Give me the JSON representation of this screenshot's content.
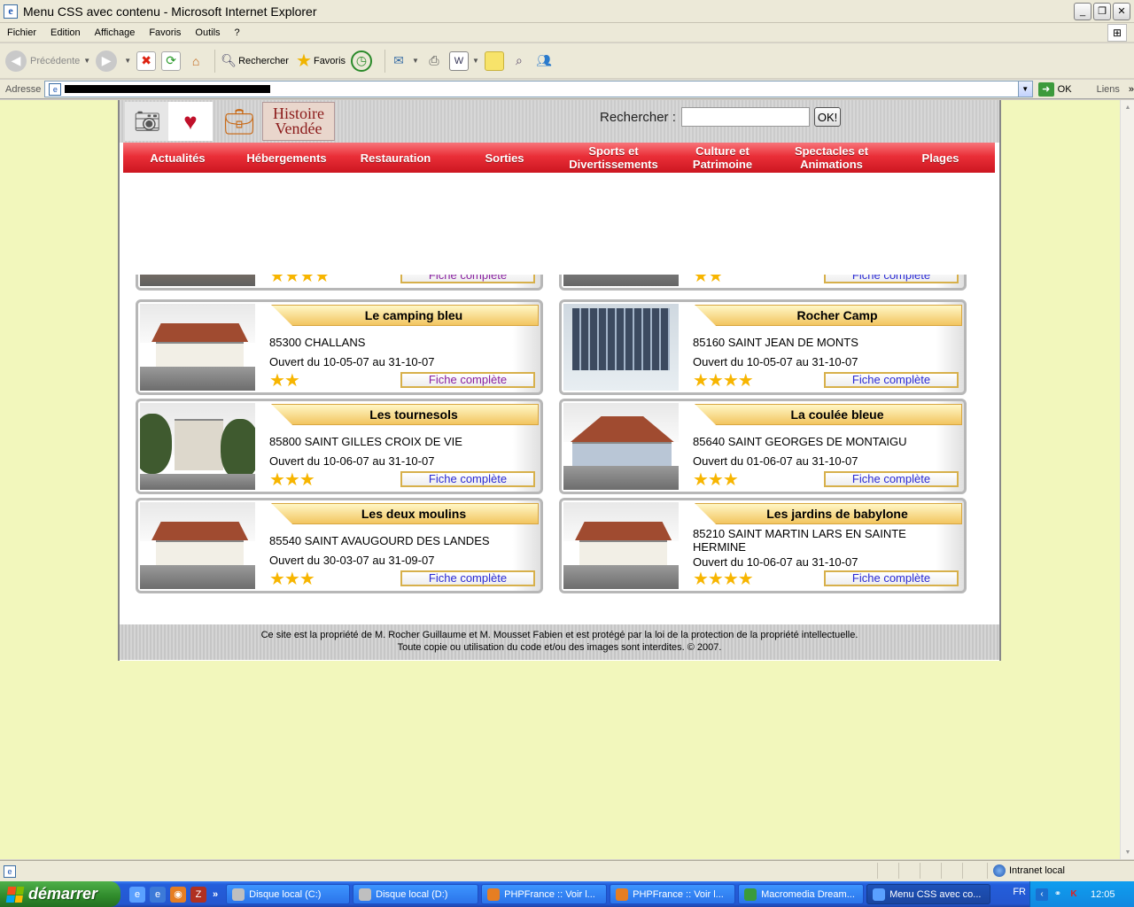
{
  "window": {
    "title": "Menu CSS avec contenu - Microsoft Internet Explorer",
    "minimize": "_",
    "maximize": "❐",
    "close": "✕"
  },
  "menubar": {
    "items": [
      "Fichier",
      "Edition",
      "Affichage",
      "Favoris",
      "Outils",
      "?"
    ]
  },
  "toolbar": {
    "back_label": "Précédente",
    "search_label": "Rechercher",
    "favorites_label": "Favoris"
  },
  "address": {
    "label": "Adresse",
    "go_label": "OK",
    "links_label": "Liens",
    "links_chevron": "»"
  },
  "site": {
    "logo_text": "Histoire Vendée",
    "search_label": "Rechercher :",
    "search_placeholder": "",
    "search_button": "OK!",
    "nav": [
      "Actualités",
      "Hébergements",
      "Restauration",
      "Sorties",
      "Sports et Divertissements",
      "Culture et Patrimoine",
      "Spectacles et Animations",
      "Plages"
    ],
    "fiche_label": "Fiche complète",
    "partial_cards": [
      {
        "stars": 4,
        "fiche_visited": true
      },
      {
        "stars": 2,
        "fiche_visited": false
      }
    ],
    "cards": [
      {
        "name": "Le camping bleu",
        "address": "85300 CHALLANS",
        "dates": "Ouvert du 10-05-07 au 31-10-07",
        "stars": 2,
        "fiche_visited": true,
        "photo": "building"
      },
      {
        "name": "Rocher Camp",
        "address": "85160 SAINT JEAN DE MONTS",
        "dates": "Ouvert du 10-05-07 au 31-10-07",
        "stars": 4,
        "fiche_visited": false,
        "photo": "glass"
      },
      {
        "name": "Les tournesols",
        "address": "85800 SAINT GILLES CROIX DE VIE",
        "dates": "Ouvert du 10-06-07 au 31-10-07",
        "stars": 3,
        "fiche_visited": false,
        "photo": "trees"
      },
      {
        "name": "La coulée bleue",
        "address": "85640 SAINT GEORGES DE MONTAIGU",
        "dates": "Ouvert du 01-06-07 au 31-10-07",
        "stars": 3,
        "fiche_visited": false,
        "photo": "pavilion"
      },
      {
        "name": "Les deux moulins",
        "address": "85540 SAINT AVAUGOURD DES LANDES",
        "dates": "Ouvert du 30-03-07 au 31-09-07",
        "stars": 3,
        "fiche_visited": false,
        "photo": "building"
      },
      {
        "name": "Les jardins de babylone",
        "address": "85210 SAINT MARTIN LARS EN SAINTE HERMINE",
        "dates": "Ouvert du 10-06-07 au 31-10-07",
        "stars": 4,
        "fiche_visited": false,
        "photo": "building"
      }
    ],
    "footer_line1": "Ce site est la propriété de M. Rocher Guillaume et M. Mousset Fabien et est protégé par la loi de la protection de la propriété intellectuelle.",
    "footer_line2": "Toute copie ou utilisation du code et/ou des images sont interdites. © 2007."
  },
  "statusbar": {
    "zone": "Intranet local"
  },
  "taskbar": {
    "start": "démarrer",
    "more": "»",
    "tasks": [
      {
        "label": "Disque local (C:)",
        "icon": "drive-icon",
        "color": "#bfbfbf",
        "active": false
      },
      {
        "label": "Disque local (D:)",
        "icon": "drive-icon",
        "color": "#bfbfbf",
        "active": false
      },
      {
        "label": "PHPFrance :: Voir l...",
        "icon": "firefox-icon",
        "color": "#e67e22",
        "active": false
      },
      {
        "label": "PHPFrance :: Voir l...",
        "icon": "firefox-icon",
        "color": "#e67e22",
        "active": false
      },
      {
        "label": "Macromedia Dream...",
        "icon": "dreamweaver-icon",
        "color": "#3a9b3a",
        "active": false
      },
      {
        "label": "Menu CSS avec co...",
        "icon": "ie-icon",
        "color": "#5aa0ff",
        "active": true
      }
    ],
    "lang": "FR",
    "clock": "12:05"
  }
}
